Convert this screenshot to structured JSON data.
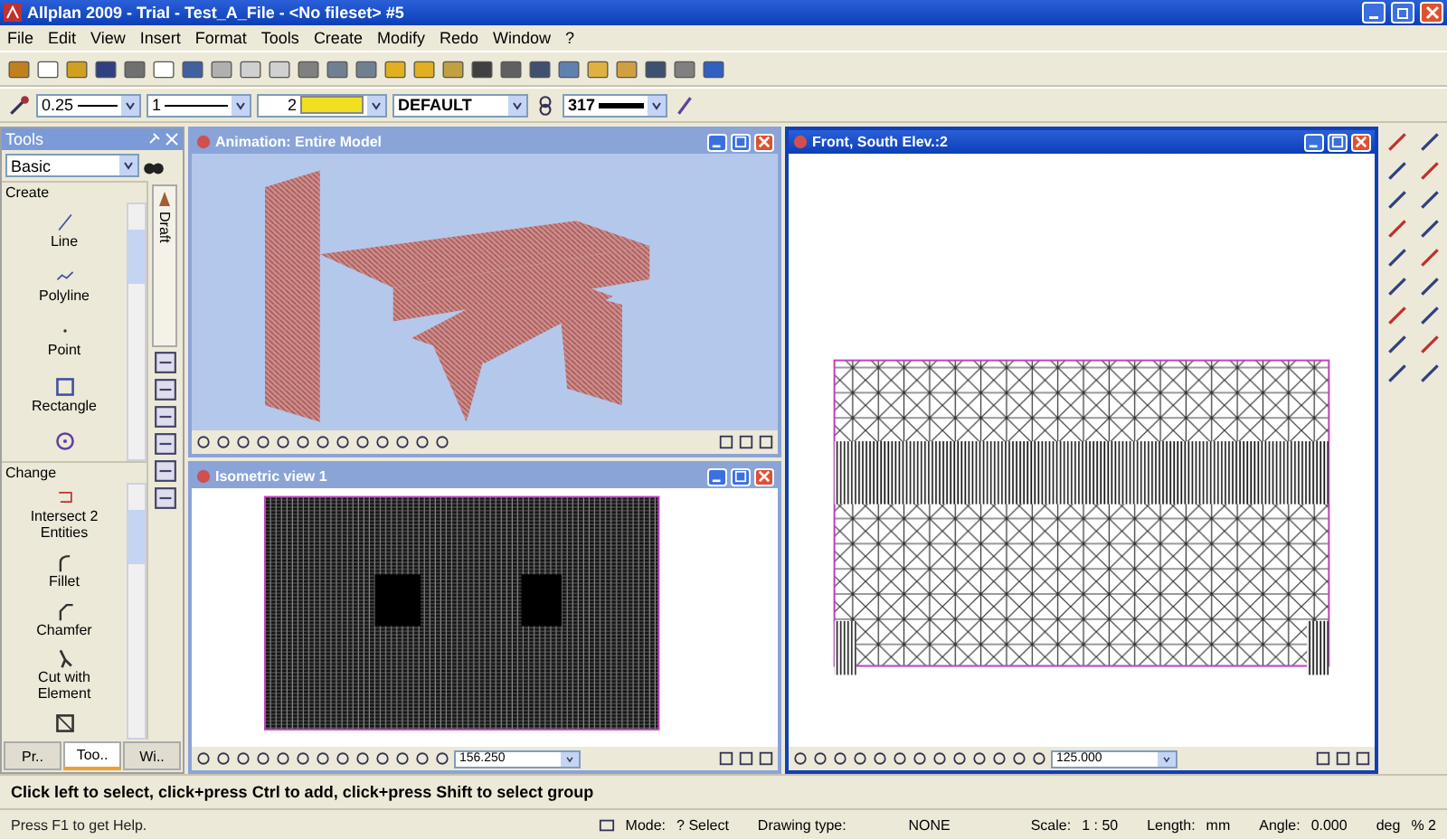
{
  "window": {
    "title": "Allplan 2009 - Trial - Test_A_File - <No fileset> #5"
  },
  "menu": [
    "File",
    "Edit",
    "View",
    "Insert",
    "Format",
    "Tools",
    "Create",
    "Modify",
    "Redo",
    "Window",
    "?"
  ],
  "format_bar": {
    "pen": "0.25",
    "line": "1",
    "color_index": "2",
    "layer": "DEFAULT",
    "pattern": "317"
  },
  "tools_panel": {
    "title": "Tools",
    "category": "Basic",
    "vertical_tab": "Draft",
    "sections": [
      {
        "title": "Create",
        "items": [
          "Line",
          "Polyline",
          "Point",
          "Rectangle"
        ]
      },
      {
        "title": "Change",
        "items": [
          "Intersect 2 Entities",
          "Fillet",
          "Chamfer",
          "Cut with Element"
        ]
      }
    ],
    "tabs": [
      {
        "label": "Pr..",
        "selected": false
      },
      {
        "label": "Too..",
        "selected": true
      },
      {
        "label": "Wi..",
        "selected": false
      }
    ]
  },
  "viewports": [
    {
      "title": "Animation: Entire Model",
      "kind": "render",
      "active": false
    },
    {
      "title": "Isometric view 1",
      "kind": "iso",
      "zoom": "156.250",
      "active": false
    },
    {
      "title": "Front, South Elev.:2",
      "kind": "front",
      "zoom": "125.000",
      "active": true
    }
  ],
  "prompt": "Click left to select, click+press Ctrl to add, click+press Shift to select group",
  "status_bar": {
    "help": "Press F1 to get Help.",
    "mode_label": "Mode:",
    "mode": "? Select",
    "drawing_type_label": "Drawing type:",
    "drawing_type": "NONE",
    "scale_label": "Scale:",
    "scale": "1 : 50",
    "length_label": "Length:",
    "length_unit": "mm",
    "angle_label": "Angle:",
    "angle": "0.000",
    "angle_unit": "deg",
    "percent": "% 2"
  }
}
